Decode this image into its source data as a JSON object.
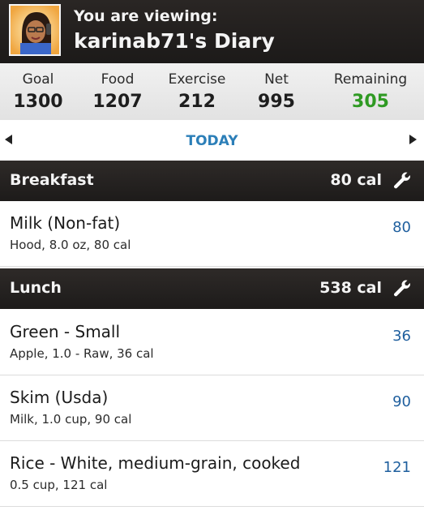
{
  "header": {
    "viewing_label": "You are viewing:",
    "diary_title": "karinab71's Diary"
  },
  "summary": {
    "goal": {
      "label": "Goal",
      "value": "1300"
    },
    "food": {
      "label": "Food",
      "value": "1207"
    },
    "exercise": {
      "label": "Exercise",
      "value": "212"
    },
    "net": {
      "label": "Net",
      "value": "995"
    },
    "remaining": {
      "label": "Remaining",
      "value": "305"
    }
  },
  "date_nav": {
    "label": "TODAY"
  },
  "meals": [
    {
      "name": "Breakfast",
      "calories": "80 cal",
      "items": [
        {
          "name": "Milk (Non-fat)",
          "detail": "Hood, 8.0 oz, 80 cal",
          "calories": "80"
        }
      ]
    },
    {
      "name": "Lunch",
      "calories": "538 cal",
      "items": [
        {
          "name": "Green - Small",
          "detail": "Apple, 1.0 - Raw, 36 cal",
          "calories": "36"
        },
        {
          "name": "Skim (Usda)",
          "detail": "Milk, 1.0 cup, 90 cal",
          "calories": "90"
        },
        {
          "name": "Rice - White, medium-grain, cooked",
          "detail": "0.5 cup, 121 cal",
          "calories": "121"
        }
      ]
    }
  ],
  "colors": {
    "accent_blue": "#2c7fb8",
    "calorie_blue": "#1f5f9e",
    "remaining_green": "#2f9a23",
    "header_dark": "#1d1b1a"
  }
}
